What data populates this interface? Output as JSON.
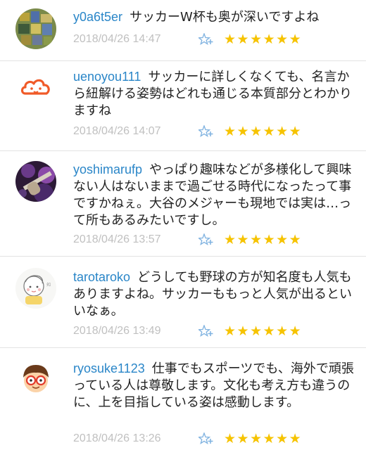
{
  "comments": [
    {
      "user": "y0a6t5er",
      "text": "サッカーW杯も奥が深いですよね",
      "timestamp": "2018/04/26 14:47",
      "stars": "★★★★★★",
      "avatar_icon": "mosaic-pattern-avatar"
    },
    {
      "user": "uenoyou111",
      "text": "サッカーに詳しくなくても、名言から紐解ける姿勢はどれも通じる本質部分とわかりますね",
      "timestamp": "2018/04/26 14:07",
      "stars": "★★★★★★",
      "avatar_icon": "orange-cloud-face-avatar"
    },
    {
      "user": "yoshimarufp",
      "text": "やっぱり趣味などが多様化して興味ない人はないままで過ごせる時代になったって事ですかねぇ。大谷のメジャーも現地では実は…って所もあるみたいですし。",
      "timestamp": "2018/04/26 13:57",
      "stars": "★★★★★★",
      "avatar_icon": "purple-guitar-avatar"
    },
    {
      "user": "tarotaroko",
      "text": "どうしても野球の方が知名度も人気もありますよね。サッカーももっと人気が出るといいなぁ。",
      "timestamp": "2018/04/26 13:49",
      "stars": "★★★★★★",
      "avatar_icon": "illustrated-child-avatar"
    },
    {
      "user": "ryosuke1123",
      "text": "仕事でもスポーツでも、海外で頑張っている人は尊敬します。文化も考え方も違うのに、上を目指している姿は感動します。",
      "timestamp": "2018/04/26 13:26",
      "stars": "★★★★★★",
      "avatar_icon": "cartoon-glasses-boy-avatar"
    }
  ],
  "colors": {
    "username": "#2a86c8",
    "timestamp": "#c0c0c0",
    "star": "#f6c300",
    "add_star_icon": "#7fb2e0"
  }
}
